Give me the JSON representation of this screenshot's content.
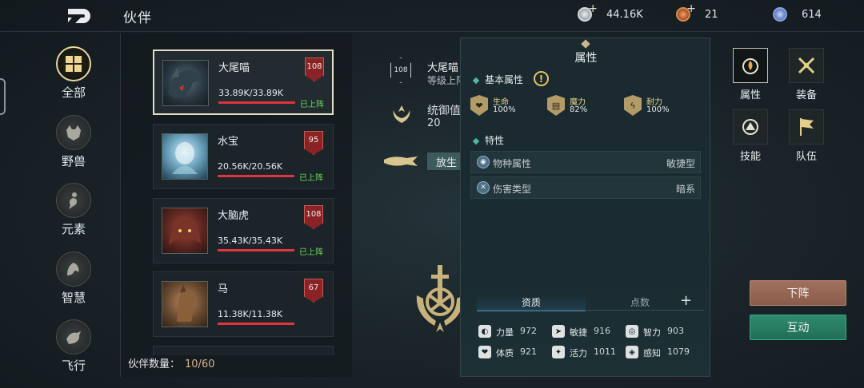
{
  "header": {
    "title": "伙伴",
    "currencies": [
      {
        "icon": "silver-coin-icon",
        "value": "44.16K",
        "color": "#c8cdd0",
        "has_plus": true
      },
      {
        "icon": "bronze-medal-icon",
        "value": "21",
        "color": "#c9733d",
        "has_plus": true
      },
      {
        "icon": "crystal-gem-icon",
        "value": "614",
        "color": "#6c8fd6",
        "has_plus": false
      }
    ]
  },
  "categories": [
    {
      "label": "全部",
      "icon": "grid-icon",
      "active": true
    },
    {
      "label": "野兽",
      "icon": "beast-icon",
      "active": false
    },
    {
      "label": "元素",
      "icon": "element-icon",
      "active": false
    },
    {
      "label": "智慧",
      "icon": "wisdom-icon",
      "active": false
    },
    {
      "label": "飞行",
      "icon": "bird-icon",
      "active": false
    }
  ],
  "pets": [
    {
      "name": "大尾喵",
      "hp": "33.89K/33.89K",
      "hp_fill": 1.0,
      "level": "108",
      "status": "已上阵",
      "portrait": "dark-dragon-portrait",
      "selected": true
    },
    {
      "name": "水宝",
      "hp": "20.56K/20.56K",
      "hp_fill": 1.0,
      "level": "95",
      "status": "已上阵",
      "portrait": "water-spirit-portrait",
      "selected": false
    },
    {
      "name": "大脑虎",
      "hp": "35.43K/35.43K",
      "hp_fill": 1.0,
      "level": "108",
      "status": "已上阵",
      "portrait": "red-beast-portrait",
      "selected": false
    },
    {
      "name": "马",
      "hp": "11.38K/11.38K",
      "hp_fill": 1.0,
      "level": "67",
      "status": "",
      "portrait": "horse-portrait",
      "selected": false
    }
  ],
  "pet_count": {
    "label": "伙伴数量：",
    "value": "10/60"
  },
  "selected_info": {
    "level": "108",
    "name": "大尾喵",
    "sub": "等级上限",
    "defense_label": "统御值",
    "defense_value": "20",
    "free_button": "放生"
  },
  "attributes": {
    "title": "属性",
    "basic_label": "基本属性",
    "stats": [
      {
        "name": "生命",
        "value": "100%",
        "icon": "heart-icon"
      },
      {
        "name": "魔力",
        "value": "82%",
        "icon": "magic-book-icon"
      },
      {
        "name": "耐力",
        "value": "100%",
        "icon": "stamina-icon"
      }
    ],
    "traits_label": "特性",
    "traits": [
      {
        "label": "物种属性",
        "value": "敏捷型",
        "icon": "species-icon"
      },
      {
        "label": "伤害类型",
        "value": "暗系",
        "icon": "damage-type-icon"
      }
    ],
    "tabs": {
      "active": "资质",
      "idle": "点数"
    },
    "aptitudes": [
      {
        "name": "力量",
        "value": "972",
        "icon": "strength-icon"
      },
      {
        "name": "敏捷",
        "value": "916",
        "icon": "agility-icon"
      },
      {
        "name": "智力",
        "value": "903",
        "icon": "intellect-icon"
      },
      {
        "name": "体质",
        "value": "921",
        "icon": "constitution-icon"
      },
      {
        "name": "活力",
        "value": "1011",
        "icon": "vitality-icon"
      },
      {
        "name": "感知",
        "value": "1079",
        "icon": "perception-icon"
      }
    ]
  },
  "side_tools": [
    {
      "label": "属性",
      "icon": "attribute-icon",
      "active": true
    },
    {
      "label": "装备",
      "icon": "crossed-swords-icon",
      "active": false
    },
    {
      "label": "技能",
      "icon": "skill-icon",
      "active": false
    },
    {
      "label": "队伍",
      "icon": "team-flag-icon",
      "active": false
    }
  ],
  "actions": {
    "dismiss": "下阵",
    "interact": "互动"
  }
}
